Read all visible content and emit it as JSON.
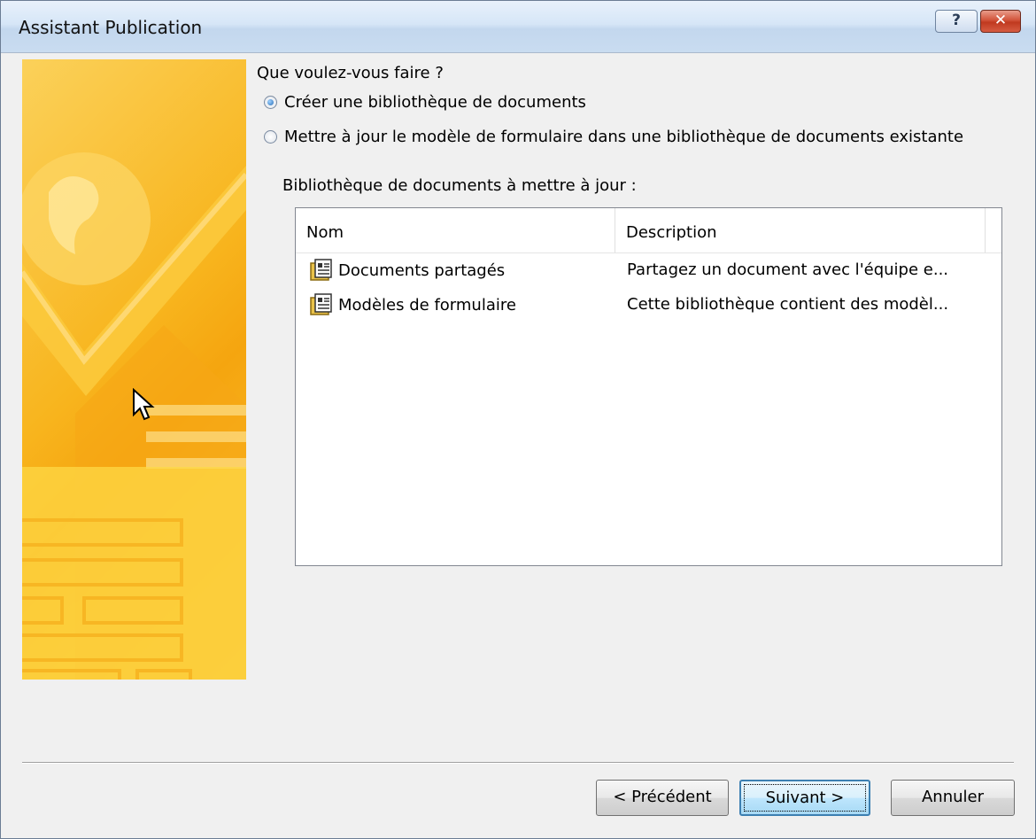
{
  "window": {
    "title": "Assistant Publication",
    "help_label": "?",
    "close_label": "✕"
  },
  "question": "Que voulez-vous faire ?",
  "options": [
    {
      "label": "Créer une bibliothèque de documents",
      "selected": true
    },
    {
      "label": "Mettre à jour le modèle de formulaire dans une bibliothèque de documents existante",
      "selected": false
    }
  ],
  "library_label": "Bibliothèque de documents à mettre à jour :",
  "listview": {
    "columns": [
      "Nom",
      "Description"
    ],
    "rows": [
      {
        "name": "Documents partagés",
        "description": "Partagez un document avec l'équipe e...",
        "icon": "document-library-icon"
      },
      {
        "name": "Modèles de formulaire",
        "description": "Cette bibliothèque contient des modèl...",
        "icon": "document-library-icon"
      }
    ]
  },
  "buttons": {
    "previous": "< Précédent",
    "next": "Suivant >",
    "cancel": "Annuler"
  },
  "colors": {
    "banner_primary": "#f8b51e",
    "titlebar": "#d6e6f7",
    "close_button": "#c0391f",
    "default_button_border": "#3c7fb1"
  }
}
